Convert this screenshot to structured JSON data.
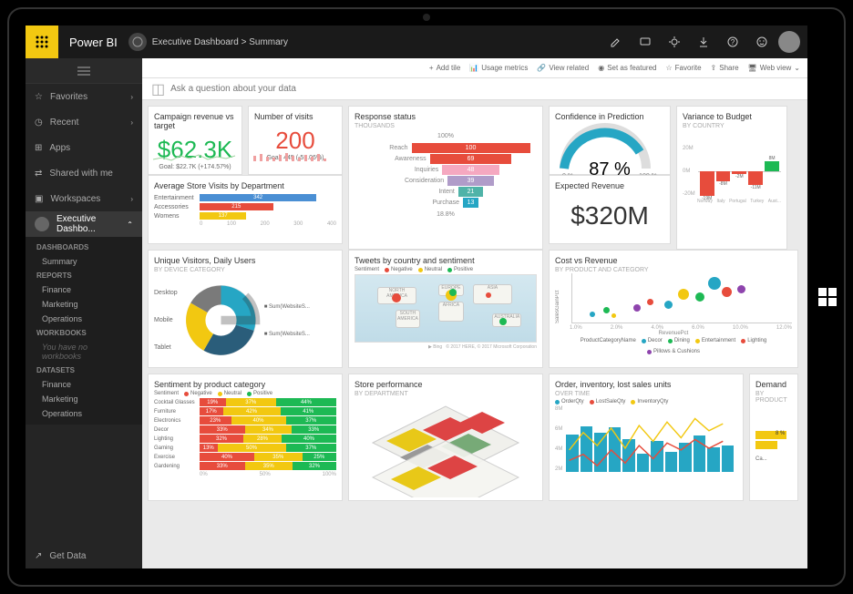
{
  "app": {
    "name": "Power BI"
  },
  "breadcrumb": {
    "workspace": "Executive Dashboard",
    "item": "Summary"
  },
  "actionbar": {
    "add_tile": "Add tile",
    "usage_metrics": "Usage metrics",
    "view_related": "View related",
    "set_featured": "Set as featured",
    "favorite": "Favorite",
    "share": "Share",
    "web_view": "Web view"
  },
  "qna": {
    "placeholder": "Ask a question about your data"
  },
  "sidebar": {
    "favorites": "Favorites",
    "recent": "Recent",
    "apps": "Apps",
    "shared": "Shared with me",
    "workspaces": "Workspaces",
    "current_ws": "Executive Dashbo...",
    "sections": {
      "dashboards": {
        "h": "DASHBOARDS",
        "items": [
          "Summary"
        ]
      },
      "reports": {
        "h": "REPORTS",
        "items": [
          "Finance",
          "Marketing",
          "Operations"
        ]
      },
      "workbooks": {
        "h": "WORKBOOKS",
        "empty": "You have no workbooks"
      },
      "datasets": {
        "h": "DATASETS",
        "items": [
          "Finance",
          "Marketing",
          "Operations"
        ]
      }
    },
    "get_data": "Get Data"
  },
  "tiles": {
    "revenue": {
      "title": "Campaign revenue vs target",
      "value": "$62.3K",
      "goal": "Goal: $22.7K (+174.57%)"
    },
    "visits": {
      "title": "Number of visits",
      "value": "200",
      "goal": "Goal: 445 (-55.06%)"
    },
    "response": {
      "title": "Response status",
      "sub": "THOUSANDS",
      "top_pct": "100%",
      "bot_pct": "18.8%"
    },
    "confidence": {
      "title": "Confidence in Prediction",
      "value": "87 %",
      "min": "0 %",
      "max": "100 %"
    },
    "variance": {
      "title": "Variance to Budget",
      "sub": "BY COUNTRY"
    },
    "expected": {
      "title": "Expected Revenue",
      "value": "$320M"
    },
    "store_visits": {
      "title": "Average Store Visits by Department"
    },
    "unique": {
      "title": "Unique Visitors, Daily Users",
      "sub": "BY DEVICE CATEGORY"
    },
    "tweets": {
      "title": "Tweets by country and sentiment"
    },
    "cost_rev": {
      "title": "Cost vs Revenue",
      "sub": "BY PRODUCT AND CATEGORY",
      "ylabel": "SalesGainPct",
      "xlabel": "RevenuePct"
    },
    "sentiment": {
      "title": "Sentiment by product category"
    },
    "store_perf": {
      "title": "Store performance",
      "sub": "BY DEPARTMENT"
    },
    "orders": {
      "title": "Order, inventory, lost sales units",
      "sub": "OVER TIME"
    },
    "demand": {
      "title": "Demand",
      "sub": "BY PRODUCT"
    }
  },
  "chart_data": {
    "response_funnel": {
      "type": "bar",
      "orientation": "horizontal",
      "categories": [
        "Reach",
        "Awareness",
        "Inquiries",
        "Consideration",
        "Intent",
        "Purchase"
      ],
      "values": [
        100,
        69,
        48,
        39,
        21,
        13
      ],
      "colors": [
        "#e74c3c",
        "#e74c3c",
        "#f5a8c0",
        "#b09cc9",
        "#4fb3a8",
        "#26a6c4"
      ]
    },
    "store_visits": {
      "type": "bar",
      "orientation": "horizontal",
      "categories": [
        "Entertainment",
        "Accessories",
        "Womens"
      ],
      "values": [
        342,
        215,
        137
      ],
      "colors": [
        "#4a8fd4",
        "#e74c3c",
        "#f2c811"
      ],
      "axis_ticks": [
        0,
        100,
        200,
        300,
        400
      ]
    },
    "confidence_gauge": {
      "type": "gauge",
      "value": 87,
      "min": 0,
      "max": 100
    },
    "variance": {
      "type": "bar",
      "categories": [
        "Norway",
        "Italy",
        "Portugal",
        "Turkey",
        "Aust..."
      ],
      "values": [
        -19,
        -8,
        -2,
        -11,
        8
      ],
      "ylim": [
        -20,
        20
      ],
      "yticks": [
        "20M",
        "0M",
        "-20M"
      ]
    },
    "unique_visitors": {
      "type": "pie",
      "categories": [
        "Desktop",
        "Mobile",
        "Tablet"
      ],
      "series_labels": [
        "Sum(WebsiteS...",
        "Sum(WebsiteS..."
      ]
    },
    "cost_vs_revenue": {
      "type": "scatter",
      "xlabel": "RevenuePct",
      "ylabel": "SalesGainPct",
      "x_ticks": [
        "1.0%",
        "2.0%",
        "4.0%",
        "6.0%",
        "10.0%",
        "12.0%"
      ],
      "legend": {
        "label": "ProductCategoryName",
        "items": [
          "Decor",
          "Dining",
          "Entertainment",
          "Lighting",
          "Pillows & Cushions"
        ]
      }
    },
    "sentiment_stacked": {
      "type": "bar",
      "stacking": "percent",
      "legend_label": "Sentiment",
      "legend_items": [
        "Negative",
        "Neutral",
        "Positive"
      ],
      "colors": [
        "#e74c3c",
        "#f2c811",
        "#1db954"
      ],
      "categories": [
        "Cocktail Glasses",
        "Furniture",
        "Electronics",
        "Decor",
        "Lighting",
        "Gaming",
        "Exercise",
        "Gardening"
      ],
      "series": [
        {
          "name": "Negative",
          "values": [
            19,
            17,
            23,
            33,
            32,
            13,
            40,
            33
          ]
        },
        {
          "name": "Neutral",
          "values": [
            37,
            42,
            40,
            34,
            28,
            50,
            35,
            35
          ]
        },
        {
          "name": "Positive",
          "values": [
            44,
            41,
            37,
            33,
            40,
            37,
            25,
            32
          ]
        }
      ],
      "axis_ticks": [
        "0%",
        "50%",
        "100%"
      ]
    },
    "orders": {
      "type": "bar+line",
      "legend_items": [
        "OrderQty",
        "LostSaleQty",
        "InventoryQty"
      ],
      "y_ticks": [
        "8M",
        "6M",
        "4M",
        "2M"
      ],
      "bars": [
        3.2,
        3.0,
        4.4,
        3.6,
        2.4,
        3.8,
        2.2,
        4.0,
        5.4,
        4.8,
        5.6,
        4.6
      ]
    },
    "tweets_map": {
      "type": "map",
      "sentiment_legend": [
        "Negative",
        "Neutral",
        "Positive"
      ],
      "continent_labels": [
        "NORTH AMERICA",
        "SOUTH AMERICA",
        "EUROPE",
        "AFRICA",
        "ASIA",
        "AUSTRALIA"
      ]
    }
  }
}
